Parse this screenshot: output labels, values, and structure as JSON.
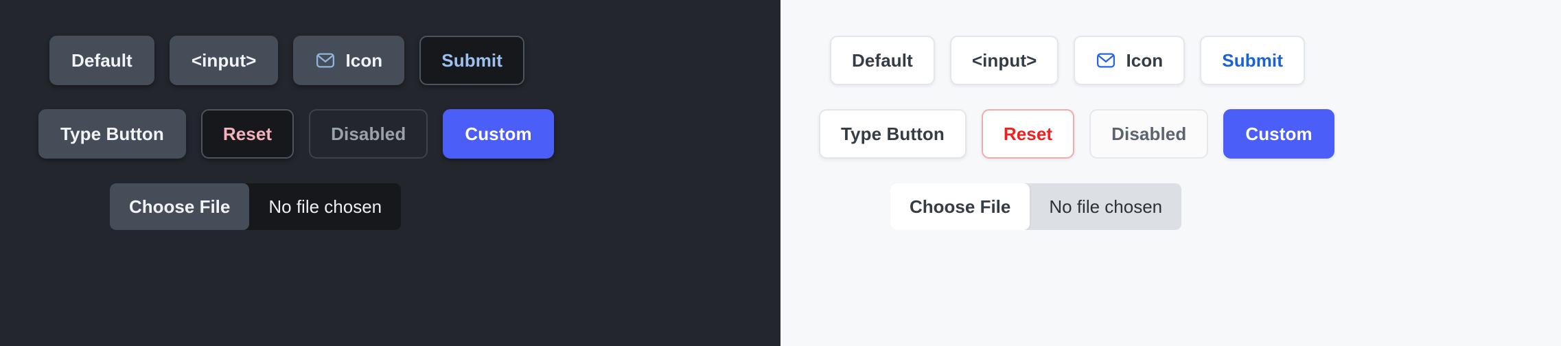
{
  "panels": [
    {
      "theme": "dark",
      "background": "#23262c",
      "rows": [
        {
          "buttons": [
            {
              "label": "Default",
              "variant": "default",
              "icon": null
            },
            {
              "label": "<input>",
              "variant": "input",
              "icon": null
            },
            {
              "label": "Icon",
              "variant": "icon",
              "icon": "envelope-icon"
            },
            {
              "label": "Submit",
              "variant": "submit",
              "icon": null
            }
          ]
        },
        {
          "buttons": [
            {
              "label": "Type Button",
              "variant": "type",
              "icon": null
            },
            {
              "label": "Reset",
              "variant": "reset",
              "icon": null
            },
            {
              "label": "Disabled",
              "variant": "disabled",
              "icon": null
            },
            {
              "label": "Custom",
              "variant": "custom",
              "icon": null
            }
          ]
        }
      ],
      "file_input": {
        "button_label": "Choose File",
        "status_text": "No file chosen"
      }
    },
    {
      "theme": "light",
      "background": "#f7f8fa",
      "rows": [
        {
          "buttons": [
            {
              "label": "Default",
              "variant": "default",
              "icon": null
            },
            {
              "label": "<input>",
              "variant": "input",
              "icon": null
            },
            {
              "label": "Icon",
              "variant": "icon",
              "icon": "envelope-icon"
            },
            {
              "label": "Submit",
              "variant": "submit",
              "icon": null
            }
          ]
        },
        {
          "buttons": [
            {
              "label": "Type Button",
              "variant": "type",
              "icon": null
            },
            {
              "label": "Reset",
              "variant": "reset",
              "icon": null
            },
            {
              "label": "Disabled",
              "variant": "disabled",
              "icon": null
            },
            {
              "label": "Custom",
              "variant": "custom",
              "icon": null
            }
          ]
        }
      ],
      "file_input": {
        "button_label": "Choose File",
        "status_text": "No file chosen"
      }
    }
  ],
  "colors": {
    "dark_panel_bg": "#23262c",
    "light_panel_bg": "#f7f8fa",
    "dark_button_bg": "#454e58",
    "dark_sunken_bg": "#16181c",
    "accent_blue": "#4b5ef7",
    "submit_blue_dark": "#9dc0f0",
    "submit_blue_light": "#1b62d6",
    "reset_pink_dark": "#f4b2bb",
    "reset_red_light": "#ef2020",
    "reset_border_light": "#f5a9a9",
    "envelope_dark": "#93b4dd",
    "envelope_light": "#2563eb"
  }
}
